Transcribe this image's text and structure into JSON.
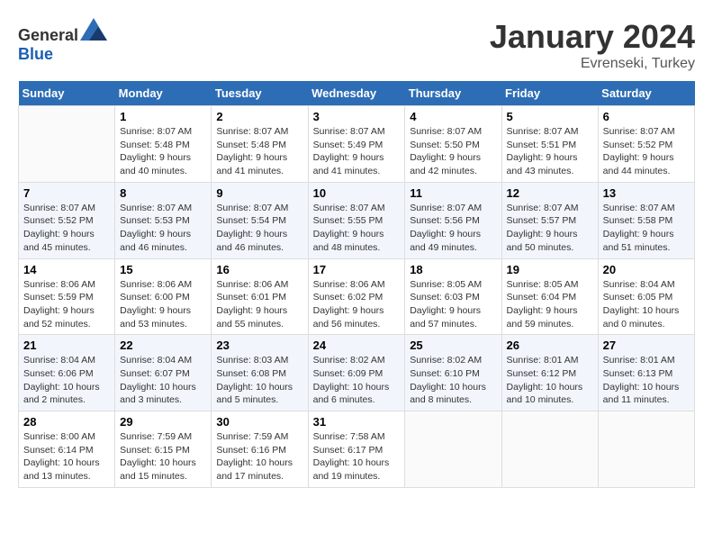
{
  "header": {
    "logo_general": "General",
    "logo_blue": "Blue",
    "month": "January 2024",
    "location": "Evrenseki, Turkey"
  },
  "days_of_week": [
    "Sunday",
    "Monday",
    "Tuesday",
    "Wednesday",
    "Thursday",
    "Friday",
    "Saturday"
  ],
  "weeks": [
    [
      {
        "day": "",
        "sunrise": "",
        "sunset": "",
        "daylight": ""
      },
      {
        "day": "1",
        "sunrise": "Sunrise: 8:07 AM",
        "sunset": "Sunset: 5:48 PM",
        "daylight": "Daylight: 9 hours and 40 minutes."
      },
      {
        "day": "2",
        "sunrise": "Sunrise: 8:07 AM",
        "sunset": "Sunset: 5:48 PM",
        "daylight": "Daylight: 9 hours and 41 minutes."
      },
      {
        "day": "3",
        "sunrise": "Sunrise: 8:07 AM",
        "sunset": "Sunset: 5:49 PM",
        "daylight": "Daylight: 9 hours and 41 minutes."
      },
      {
        "day": "4",
        "sunrise": "Sunrise: 8:07 AM",
        "sunset": "Sunset: 5:50 PM",
        "daylight": "Daylight: 9 hours and 42 minutes."
      },
      {
        "day": "5",
        "sunrise": "Sunrise: 8:07 AM",
        "sunset": "Sunset: 5:51 PM",
        "daylight": "Daylight: 9 hours and 43 minutes."
      },
      {
        "day": "6",
        "sunrise": "Sunrise: 8:07 AM",
        "sunset": "Sunset: 5:52 PM",
        "daylight": "Daylight: 9 hours and 44 minutes."
      }
    ],
    [
      {
        "day": "7",
        "sunrise": "Sunrise: 8:07 AM",
        "sunset": "Sunset: 5:52 PM",
        "daylight": "Daylight: 9 hours and 45 minutes."
      },
      {
        "day": "8",
        "sunrise": "Sunrise: 8:07 AM",
        "sunset": "Sunset: 5:53 PM",
        "daylight": "Daylight: 9 hours and 46 minutes."
      },
      {
        "day": "9",
        "sunrise": "Sunrise: 8:07 AM",
        "sunset": "Sunset: 5:54 PM",
        "daylight": "Daylight: 9 hours and 46 minutes."
      },
      {
        "day": "10",
        "sunrise": "Sunrise: 8:07 AM",
        "sunset": "Sunset: 5:55 PM",
        "daylight": "Daylight: 9 hours and 48 minutes."
      },
      {
        "day": "11",
        "sunrise": "Sunrise: 8:07 AM",
        "sunset": "Sunset: 5:56 PM",
        "daylight": "Daylight: 9 hours and 49 minutes."
      },
      {
        "day": "12",
        "sunrise": "Sunrise: 8:07 AM",
        "sunset": "Sunset: 5:57 PM",
        "daylight": "Daylight: 9 hours and 50 minutes."
      },
      {
        "day": "13",
        "sunrise": "Sunrise: 8:07 AM",
        "sunset": "Sunset: 5:58 PM",
        "daylight": "Daylight: 9 hours and 51 minutes."
      }
    ],
    [
      {
        "day": "14",
        "sunrise": "Sunrise: 8:06 AM",
        "sunset": "Sunset: 5:59 PM",
        "daylight": "Daylight: 9 hours and 52 minutes."
      },
      {
        "day": "15",
        "sunrise": "Sunrise: 8:06 AM",
        "sunset": "Sunset: 6:00 PM",
        "daylight": "Daylight: 9 hours and 53 minutes."
      },
      {
        "day": "16",
        "sunrise": "Sunrise: 8:06 AM",
        "sunset": "Sunset: 6:01 PM",
        "daylight": "Daylight: 9 hours and 55 minutes."
      },
      {
        "day": "17",
        "sunrise": "Sunrise: 8:06 AM",
        "sunset": "Sunset: 6:02 PM",
        "daylight": "Daylight: 9 hours and 56 minutes."
      },
      {
        "day": "18",
        "sunrise": "Sunrise: 8:05 AM",
        "sunset": "Sunset: 6:03 PM",
        "daylight": "Daylight: 9 hours and 57 minutes."
      },
      {
        "day": "19",
        "sunrise": "Sunrise: 8:05 AM",
        "sunset": "Sunset: 6:04 PM",
        "daylight": "Daylight: 9 hours and 59 minutes."
      },
      {
        "day": "20",
        "sunrise": "Sunrise: 8:04 AM",
        "sunset": "Sunset: 6:05 PM",
        "daylight": "Daylight: 10 hours and 0 minutes."
      }
    ],
    [
      {
        "day": "21",
        "sunrise": "Sunrise: 8:04 AM",
        "sunset": "Sunset: 6:06 PM",
        "daylight": "Daylight: 10 hours and 2 minutes."
      },
      {
        "day": "22",
        "sunrise": "Sunrise: 8:04 AM",
        "sunset": "Sunset: 6:07 PM",
        "daylight": "Daylight: 10 hours and 3 minutes."
      },
      {
        "day": "23",
        "sunrise": "Sunrise: 8:03 AM",
        "sunset": "Sunset: 6:08 PM",
        "daylight": "Daylight: 10 hours and 5 minutes."
      },
      {
        "day": "24",
        "sunrise": "Sunrise: 8:02 AM",
        "sunset": "Sunset: 6:09 PM",
        "daylight": "Daylight: 10 hours and 6 minutes."
      },
      {
        "day": "25",
        "sunrise": "Sunrise: 8:02 AM",
        "sunset": "Sunset: 6:10 PM",
        "daylight": "Daylight: 10 hours and 8 minutes."
      },
      {
        "day": "26",
        "sunrise": "Sunrise: 8:01 AM",
        "sunset": "Sunset: 6:12 PM",
        "daylight": "Daylight: 10 hours and 10 minutes."
      },
      {
        "day": "27",
        "sunrise": "Sunrise: 8:01 AM",
        "sunset": "Sunset: 6:13 PM",
        "daylight": "Daylight: 10 hours and 11 minutes."
      }
    ],
    [
      {
        "day": "28",
        "sunrise": "Sunrise: 8:00 AM",
        "sunset": "Sunset: 6:14 PM",
        "daylight": "Daylight: 10 hours and 13 minutes."
      },
      {
        "day": "29",
        "sunrise": "Sunrise: 7:59 AM",
        "sunset": "Sunset: 6:15 PM",
        "daylight": "Daylight: 10 hours and 15 minutes."
      },
      {
        "day": "30",
        "sunrise": "Sunrise: 7:59 AM",
        "sunset": "Sunset: 6:16 PM",
        "daylight": "Daylight: 10 hours and 17 minutes."
      },
      {
        "day": "31",
        "sunrise": "Sunrise: 7:58 AM",
        "sunset": "Sunset: 6:17 PM",
        "daylight": "Daylight: 10 hours and 19 minutes."
      },
      {
        "day": "",
        "sunrise": "",
        "sunset": "",
        "daylight": ""
      },
      {
        "day": "",
        "sunrise": "",
        "sunset": "",
        "daylight": ""
      },
      {
        "day": "",
        "sunrise": "",
        "sunset": "",
        "daylight": ""
      }
    ]
  ]
}
